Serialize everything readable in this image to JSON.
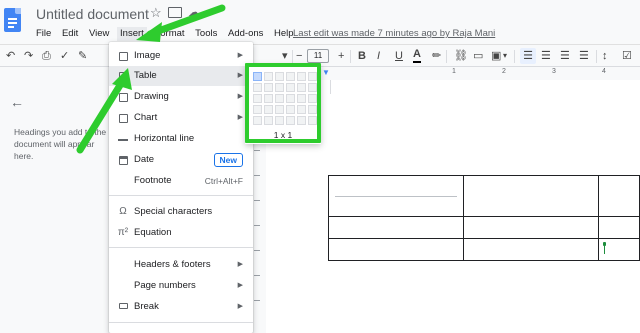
{
  "header": {
    "doc_title": "Untitled document",
    "star_icon": "star-icon",
    "last_edit": "Last edit was made 7 minutes ago by Raja Mani"
  },
  "menubar": {
    "items": [
      "File",
      "Edit",
      "View",
      "Insert",
      "Format",
      "Tools",
      "Add-ons",
      "Help"
    ],
    "active": "Insert"
  },
  "toolbar": {
    "font_size": "11",
    "minus": "−",
    "plus": "+",
    "bold": "B",
    "italic": "I",
    "underline": "U",
    "text_color": "A"
  },
  "sidebar": {
    "hint": "Headings you add to the document will appear here."
  },
  "ruler": {
    "marks": [
      "1",
      "2",
      "3",
      "4"
    ]
  },
  "insert_menu": {
    "items": [
      {
        "label": "Image",
        "icon": "image-icon",
        "arrow": "▶"
      },
      {
        "label": "Table",
        "icon": "table-icon",
        "arrow": "▶"
      },
      {
        "label": "Drawing",
        "icon": "drawing-icon",
        "arrow": "▶"
      },
      {
        "label": "Chart",
        "icon": "chart-icon",
        "arrow": "▶"
      },
      {
        "label": "Horizontal line",
        "icon": "horizontal-line-icon"
      },
      {
        "label": "Date",
        "icon": "date-icon",
        "badge": "New"
      },
      {
        "label": "Footnote",
        "shortcut": "Ctrl+Alt+F"
      },
      {
        "label": "Special characters",
        "icon": "omega-icon"
      },
      {
        "label": "Equation",
        "icon": "pi-icon"
      },
      {
        "label": "Headers & footers",
        "arrow": "▶"
      },
      {
        "label": "Page numbers",
        "arrow": "▶"
      },
      {
        "label": "Break",
        "icon": "break-icon",
        "arrow": "▶"
      }
    ]
  },
  "table_picker": {
    "size_label": "1 x 1"
  },
  "colors": {
    "accent": "#1a73e8",
    "highlight_green": "#2ecc2e",
    "docs_blue": "#4285f4"
  }
}
